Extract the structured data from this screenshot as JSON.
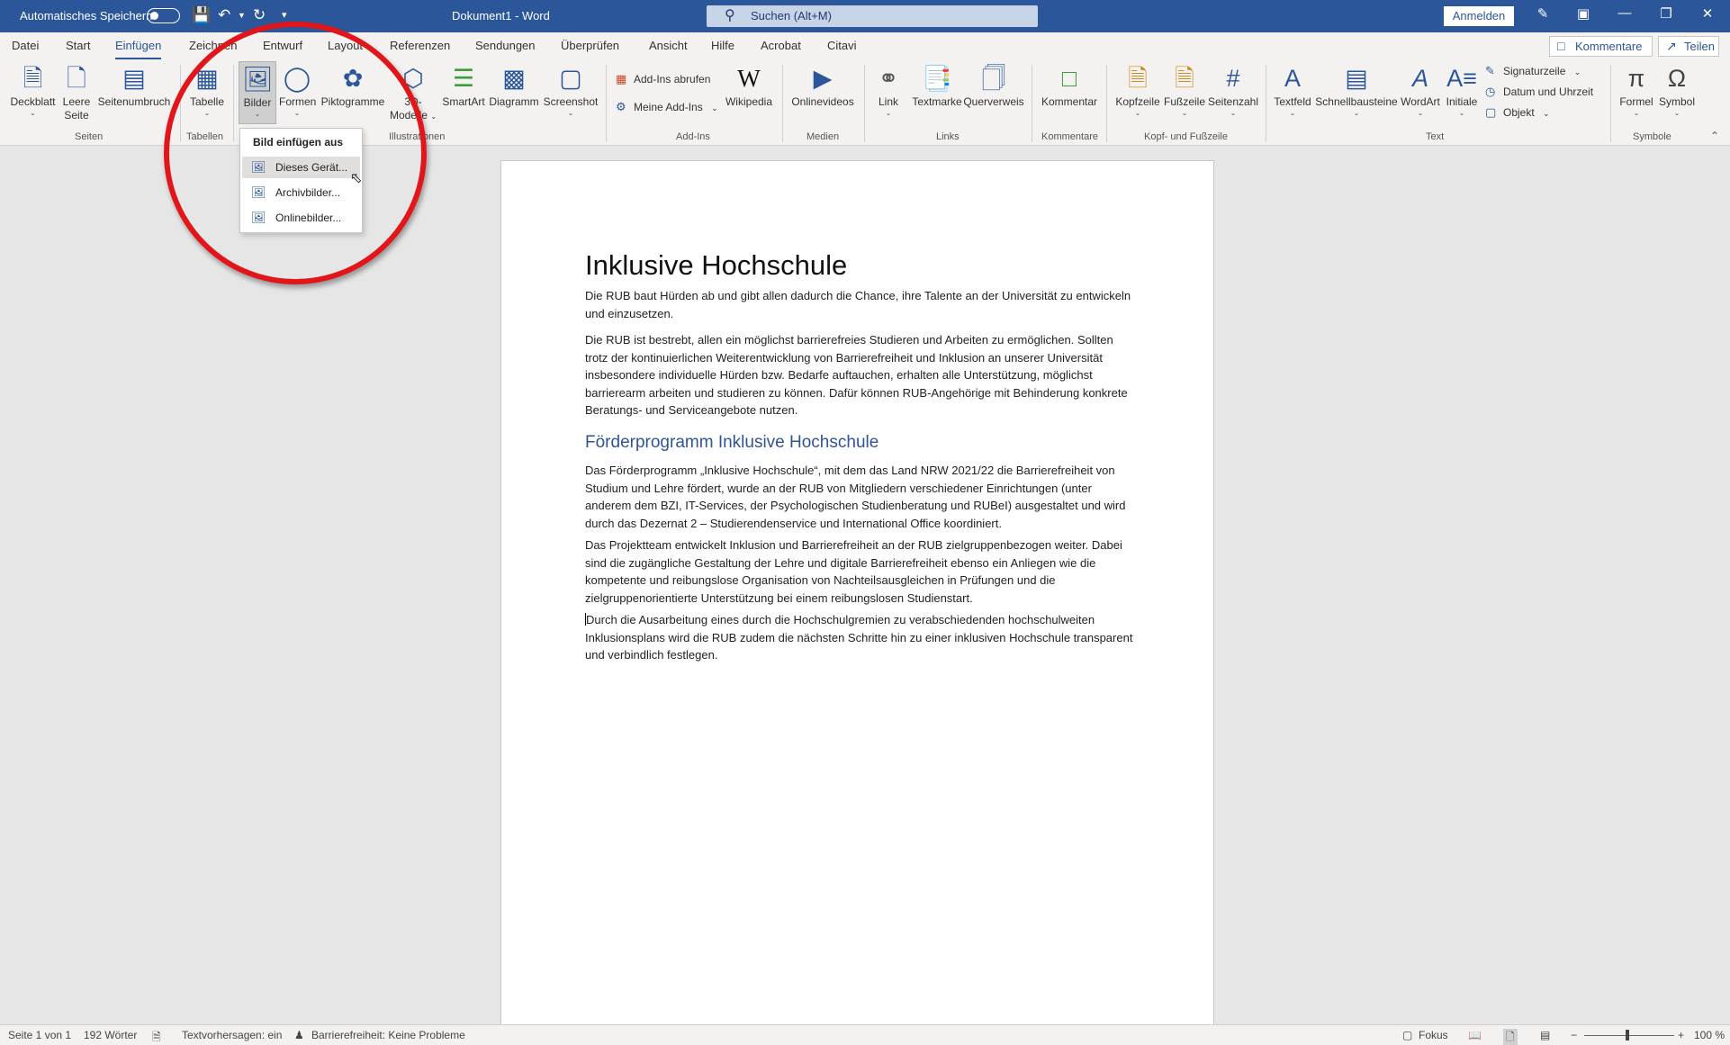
{
  "titlebar": {
    "autosave_label": "Automatisches Speichern",
    "doc_title": "Dokument1  -  Word",
    "search_placeholder": "Suchen (Alt+M)",
    "signin_label": "Anmelden"
  },
  "tabs": {
    "items": [
      "Datei",
      "Start",
      "Einfügen",
      "Zeichnen",
      "Entwurf",
      "Layout",
      "Referenzen",
      "Sendungen",
      "Überprüfen",
      "Ansicht",
      "Hilfe",
      "Acrobat",
      "Citavi"
    ],
    "active": "Einfügen",
    "comments_label": "Kommentare",
    "share_label": "Teilen"
  },
  "ribbon": {
    "deckblatt": "Deckblatt",
    "leere_seite_1": "Leere",
    "leere_seite_2": "Seite",
    "seitenumbruch": "Seitenumbruch",
    "tabelle": "Tabelle",
    "bilder": "Bilder",
    "formen": "Formen",
    "piktogramme": "Piktogramme",
    "modelle_1": "3D-",
    "modelle_2": "Modelle",
    "smartart": "SmartArt",
    "diagramm": "Diagramm",
    "screenshot": "Screenshot",
    "addins_abrufen": "Add-Ins abrufen",
    "meine_addins": "Meine Add-Ins",
    "wikipedia": "Wikipedia",
    "onlinevideos": "Onlinevideos",
    "link": "Link",
    "textmarke": "Textmarke",
    "querverweis": "Querverweis",
    "kommentar": "Kommentar",
    "kopfzeile": "Kopfzeile",
    "fusszeile": "Fußzeile",
    "seitenzahl": "Seitenzahl",
    "textfeld": "Textfeld",
    "schnellbausteine": "Schnellbausteine",
    "wordart": "WordArt",
    "initiale": "Initiale",
    "signaturzeile": "Signaturzeile",
    "datum_uhrzeit": "Datum und Uhrzeit",
    "objekt": "Objekt",
    "formel": "Formel",
    "symbol": "Symbol",
    "groups": {
      "seiten": "Seiten",
      "tabellen": "Tabellen",
      "illustrationen": "Illustrationen",
      "addins": "Add-Ins",
      "medien": "Medien",
      "links": "Links",
      "kommentare": "Kommentare",
      "kopf_fuss": "Kopf- und Fußzeile",
      "text": "Text",
      "symbole": "Symbole"
    }
  },
  "menu": {
    "heading": "Bild einfügen aus",
    "items": [
      "Dieses Gerät...",
      "Archivbilder...",
      "Onlinebilder..."
    ],
    "highlighted": "Dieses Gerät..."
  },
  "document": {
    "title": "Inklusive Hochschule",
    "p1": "Die RUB baut Hürden ab und gibt allen dadurch die Chance, ihre Talente an der Universität zu entwickeln und einzusetzen.",
    "p2": "Die RUB ist bestrebt, allen ein möglichst barrierefreies Studieren und Arbeiten zu ermöglichen. Sollten trotz der kontinuierlichen Weiterentwicklung von Barrierefreiheit und Inklusion an unserer Universität insbesondere individuelle Hürden bzw. Bedarfe auftauchen, erhalten alle Unterstützung, möglichst barrierearm arbeiten und studieren zu können. Dafür können RUB-Angehörige mit Behinderung konkrete Beratungs- und Serviceangebote nutzen.",
    "h2": "Förderprogramm Inklusive Hochschule",
    "p3": "Das Förderprogramm „Inklusive Hochschule“, mit dem das Land NRW 2021/22 die Barrierefreiheit von Studium und Lehre fördert, wurde an der RUB von Mitgliedern verschiedener Einrichtungen (unter anderem dem BZI, IT-Services, der Psychologischen Studienberatung und RUBeI) ausgestaltet und wird durch das Dezernat 2 – Studierendenservice und International Office koordiniert.",
    "p4": "Das Projektteam entwickelt Inklusion und Barrierefreiheit an der RUB zielgruppenbezogen weiter. Dabei sind die zugängliche Gestaltung der Lehre und digitale Barrierefreiheit ebenso ein Anliegen wie die kompetente und reibungslose Organisation von Nachteilsausgleichen in Prüfungen und die zielgruppenorientierte Unterstützung bei einem reibungslosen Studienstart.",
    "p5": "Durch die Ausarbeitung eines durch die Hochschulgremien zu verabschiedenden hochschulweiten Inklusionsplans wird die RUB zudem die nächsten Schritte hin zu einer inklusiven Hochschule transparent und verbindlich festlegen."
  },
  "statusbar": {
    "page": "Seite 1 von 1",
    "words": "192 Wörter",
    "predictions": "Textvorhersagen: ein",
    "accessibility": "Barrierefreiheit: Keine Probleme",
    "focus": "Fokus",
    "zoom": "100 %"
  },
  "colors": {
    "accent": "#2b579a",
    "annotation": "#e0161b",
    "heading2": "#2f5496"
  }
}
